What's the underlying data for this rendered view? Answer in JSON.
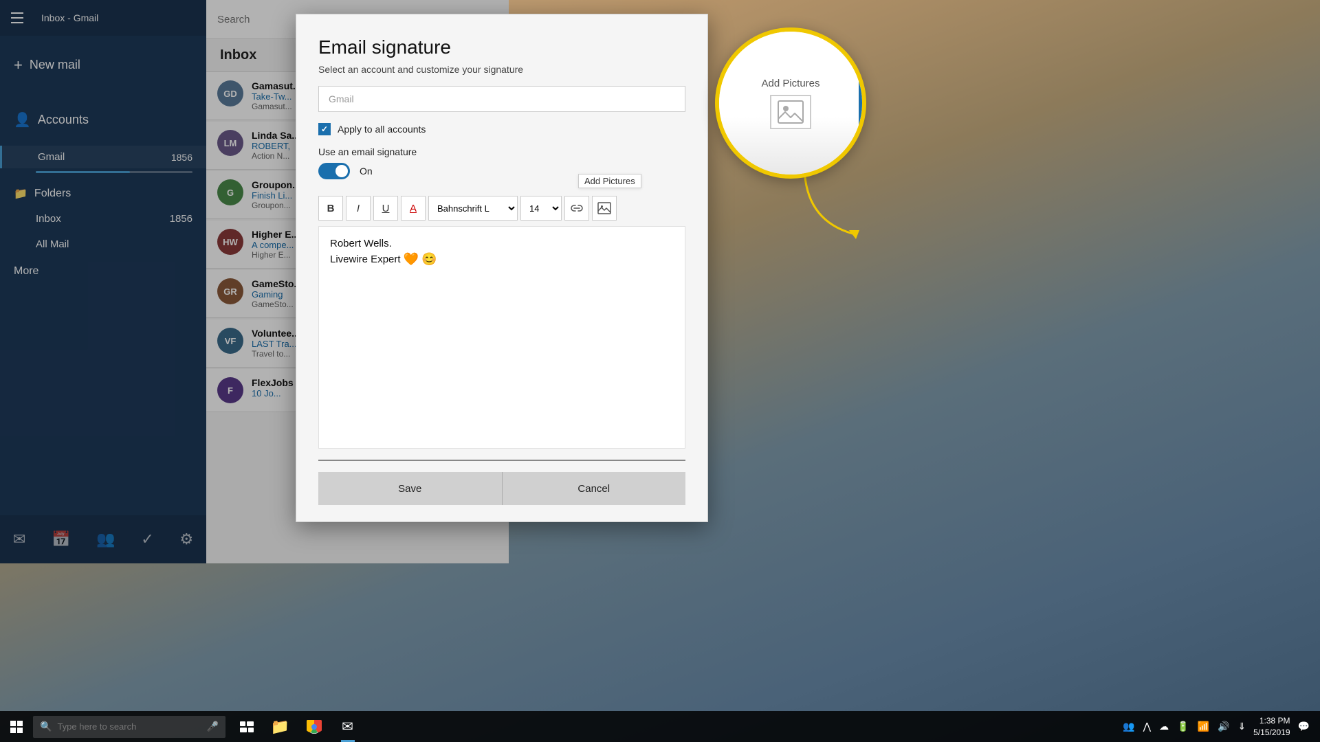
{
  "window": {
    "title": "Inbox - Gmail"
  },
  "sidebar": {
    "title": "Inbox - Gmail",
    "new_mail_label": "New mail",
    "accounts_label": "Accounts",
    "gmail_label": "Gmail",
    "gmail_count": "1856",
    "folders_label": "Folders",
    "inbox_label": "Inbox",
    "inbox_count": "1856",
    "all_mail_label": "All Mail",
    "more_label": "More"
  },
  "search": {
    "placeholder": "Search"
  },
  "inbox": {
    "title": "Inbox",
    "emails": [
      {
        "id": 1,
        "sender": "Gamasut...",
        "subject": "Take-Tw...",
        "preview": "Gamasut...",
        "avatar_initials": "GD",
        "avatar_color": "#5a7a9a"
      },
      {
        "id": 2,
        "sender": "Linda Sa...",
        "subject": "ROBERT,",
        "preview": "Action N...",
        "avatar_initials": "LM",
        "avatar_color": "#6a5a8a"
      },
      {
        "id": 3,
        "sender": "Groupon...",
        "subject": "Finish Li...",
        "preview": "Groupon...",
        "avatar_initials": "G",
        "avatar_color": "#4a8a4a"
      },
      {
        "id": 4,
        "sender": "Higher E...",
        "subject": "A compe...",
        "preview": "Higher E...",
        "avatar_initials": "HW",
        "avatar_color": "#8a3a3a"
      },
      {
        "id": 5,
        "sender": "GameSto...",
        "subject": "Gaming",
        "preview": "GameSto...",
        "avatar_initials": "GR",
        "avatar_color": "#8a5a3a"
      },
      {
        "id": 6,
        "sender": "Voluntee...",
        "subject": "LAST Tra...",
        "preview": "Travel to...",
        "avatar_initials": "VF",
        "avatar_color": "#3a6a8a"
      },
      {
        "id": 7,
        "sender": "FlexJobs",
        "subject": "10 Jo...",
        "preview": "",
        "avatar_initials": "F",
        "avatar_color": "#5a3a8a"
      }
    ]
  },
  "modal": {
    "title": "Email signature",
    "subtitle": "Select an account and customize your signature",
    "account_placeholder": "Gmail",
    "apply_all_label": "Apply to all accounts",
    "use_signature_label": "Use an email signature",
    "toggle_state": "On",
    "toolbar": {
      "bold_label": "B",
      "italic_label": "I",
      "underline_label": "U",
      "color_label": "A",
      "font_value": "Bahnschrift L",
      "size_value": "14",
      "add_pictures_label": "Add Pictures"
    },
    "signature_line1": "Robert Wells.",
    "signature_line2": "Livewire Expert",
    "signature_emoji1": "🧡",
    "signature_emoji2": "😊",
    "save_label": "Save",
    "cancel_label": "Cancel"
  },
  "magnify": {
    "add_pictures_label": "Add Pictures"
  },
  "taskbar": {
    "search_placeholder": "Type here to search",
    "time": "1:38 PM",
    "date": "5/15/2019"
  }
}
